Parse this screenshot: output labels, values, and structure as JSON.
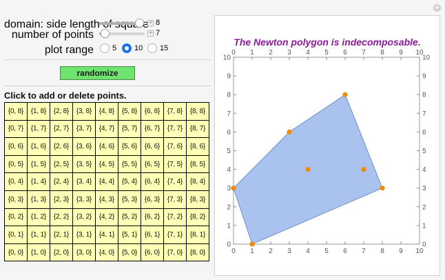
{
  "controls": {
    "domain": {
      "label": "domain: side length of square",
      "value": "8",
      "fraction": 0.875
    },
    "num_points": {
      "label": "number of points",
      "value": "7",
      "fraction": 0.125
    },
    "plot_range": {
      "label": "plot range",
      "options": [
        "5",
        "10",
        "15"
      ],
      "selected": "10"
    },
    "randomize_label": "randomize"
  },
  "instructions": "Click to add or delete points.",
  "grid": {
    "rows": [
      [
        "{0, 8}",
        "{1, 8}",
        "{2, 8}",
        "{3, 8}",
        "{4, 8}",
        "{5, 8}",
        "{6, 8}",
        "{7, 8}",
        "{8, 8}"
      ],
      [
        "{0, 7}",
        "{1, 7}",
        "{2, 7}",
        "{3, 7}",
        "{4, 7}",
        "{5, 7}",
        "{6, 7}",
        "{7, 7}",
        "{8, 7}"
      ],
      [
        "{0, 6}",
        "{1, 6}",
        "{2, 6}",
        "{3, 6}",
        "{4, 6}",
        "{5, 6}",
        "{6, 6}",
        "{7, 6}",
        "{8, 6}"
      ],
      [
        "{0, 5}",
        "{1, 5}",
        "{2, 5}",
        "{3, 5}",
        "{4, 5}",
        "{5, 5}",
        "{6, 5}",
        "{7, 5}",
        "{8, 5}"
      ],
      [
        "{0, 4}",
        "{1, 4}",
        "{2, 4}",
        "{3, 4}",
        "{4, 4}",
        "{5, 4}",
        "{6, 4}",
        "{7, 4}",
        "{8, 4}"
      ],
      [
        "{0, 3}",
        "{1, 3}",
        "{2, 3}",
        "{3, 3}",
        "{4, 3}",
        "{5, 3}",
        "{6, 3}",
        "{7, 3}",
        "{8, 3}"
      ],
      [
        "{0, 2}",
        "{1, 2}",
        "{2, 2}",
        "{3, 2}",
        "{4, 2}",
        "{5, 2}",
        "{6, 2}",
        "{7, 2}",
        "{8, 2}"
      ],
      [
        "{0, 1}",
        "{1, 1}",
        "{2, 1}",
        "{3, 1}",
        "{4, 1}",
        "{5, 1}",
        "{6, 1}",
        "{7, 1}",
        "{8, 1}"
      ],
      [
        "{0, 0}",
        "{1, 0}",
        "{2, 0}",
        "{3, 0}",
        "{4, 0}",
        "{5, 0}",
        "{6, 0}",
        "{7, 0}",
        "{8, 0}"
      ]
    ]
  },
  "colors": {
    "title": "#8b1a9a",
    "polygon_fill": "#a9c3ee",
    "polygon_stroke": "#6d8fc9",
    "point": "#f28a0b",
    "grid_cell": "#ffffb6",
    "button": "#6ee36e"
  },
  "chart_data": {
    "type": "scatter",
    "title": "The Newton polygon is indecomposable.",
    "xlim": [
      0,
      10
    ],
    "ylim": [
      0,
      10
    ],
    "ticks": [
      0,
      1,
      2,
      3,
      4,
      5,
      6,
      7,
      8,
      9,
      10
    ],
    "points": [
      [
        0,
        3
      ],
      [
        1,
        0
      ],
      [
        3,
        6
      ],
      [
        4,
        4
      ],
      [
        6,
        8
      ],
      [
        7,
        4
      ],
      [
        8,
        3
      ]
    ],
    "polygon": [
      [
        0,
        3
      ],
      [
        3,
        6
      ],
      [
        6,
        8
      ],
      [
        8,
        3
      ],
      [
        1,
        0
      ]
    ]
  }
}
